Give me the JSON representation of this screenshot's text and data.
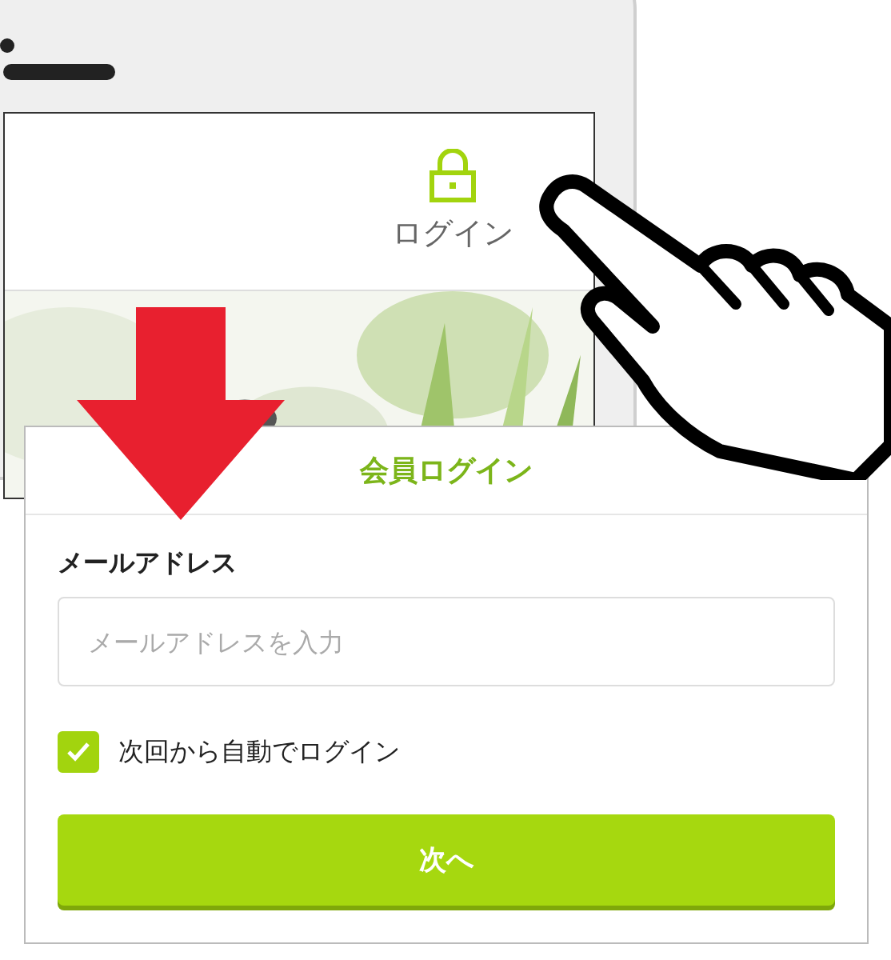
{
  "phone": {
    "header_link": "ログイン"
  },
  "login": {
    "title": "会員ログイン",
    "email_label": "メールアドレス",
    "email_field": {
      "placeholder": "メールアドレスを入力"
    },
    "remember": {
      "label": "次回から自動でログイン",
      "checked": true
    },
    "submit": "次へ"
  }
}
